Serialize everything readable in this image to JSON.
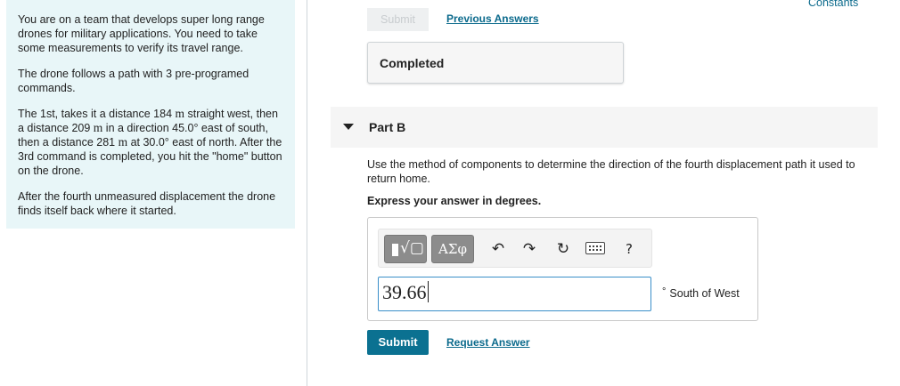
{
  "problem": {
    "p1": "You are on a team that develops super long range drones for military applications.  You need to take some measurements to verify its travel range.",
    "p2": "The drone follows a path with 3 pre-programed commands.",
    "p3": {
      "t1": "The 1st, takes it a distance 184 ",
      "m1": "m",
      "t2": " straight west, then a distance 209 ",
      "m2": "m",
      "t3": " in a direction 45.0° east of south, then a distance 281 ",
      "m3": "m",
      "t4": " at 30.0° east of north.  After the 3rd command is completed, you hit the \"home\" button on the drone."
    },
    "p4": "After the fourth unmeasured displacement the drone finds itself back where it started."
  },
  "header": {
    "constants_link": "Constants"
  },
  "part_a": {
    "submit_label": "Submit",
    "previous_answers_label": "Previous Answers",
    "completed_label": "Completed"
  },
  "part_b": {
    "title": "Part B",
    "question": "Use the method of components to determine the direction of the fourth displacement path it used to return home.",
    "instruction": "Express your answer in degrees.",
    "toolbar": {
      "templates_icon": "templates-icon",
      "symbols_label": "ΑΣφ",
      "undo_icon": "undo-icon",
      "redo_icon": "redo-icon",
      "reset_icon": "reset-icon",
      "keyboard_icon": "keyboard-icon",
      "help_label": "?"
    },
    "answer_value": "39.66",
    "unit_degree": "°",
    "unit_label": "South of West",
    "submit_label": "Submit",
    "request_answer_label": "Request Answer"
  },
  "colors": {
    "panel_bg": "#e8f6f8",
    "accent": "#0b7191",
    "link": "#0b6a8c",
    "input_focus": "#3a8fc9"
  }
}
